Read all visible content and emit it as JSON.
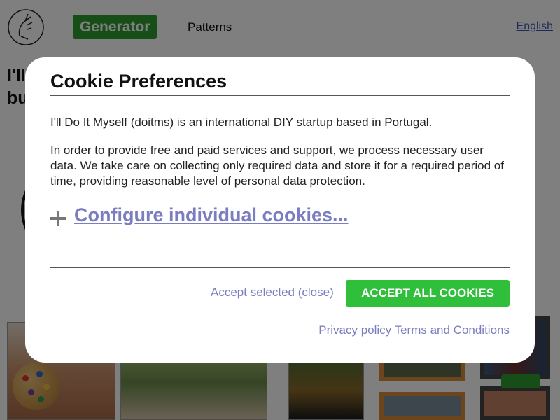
{
  "header": {
    "nav_generator": "Generator",
    "nav_patterns": "Patterns",
    "language": "English"
  },
  "hero": {
    "line1": "I'll",
    "line2": "bu"
  },
  "modal": {
    "title": "Cookie Preferences",
    "paragraph1": "I'll Do It Myself (doitms) is an international DIY startup based in Portugal.",
    "paragraph2": "In order to provide free and paid services and support, we process necessary user data. We take care on collecting only required data and store it for a required period of time, providing reasonable level of personal data protection.",
    "configure_link": "Configure individual cookies...",
    "accept_selected": "Accept selected (close)",
    "accept_all": "ACCEPT ALL COOKIES",
    "privacy_policy": "Privacy policy",
    "terms": "Terms and Conditions"
  },
  "colors": {
    "nav_generator_bg": "#2e9c2e",
    "accept_all_bg": "#2fbf3a",
    "link": "#7a7dbf",
    "overlay": "rgba(0,0,0,0.5)"
  },
  "icons": [
    "hand-logo-icon",
    "plus-icon"
  ]
}
